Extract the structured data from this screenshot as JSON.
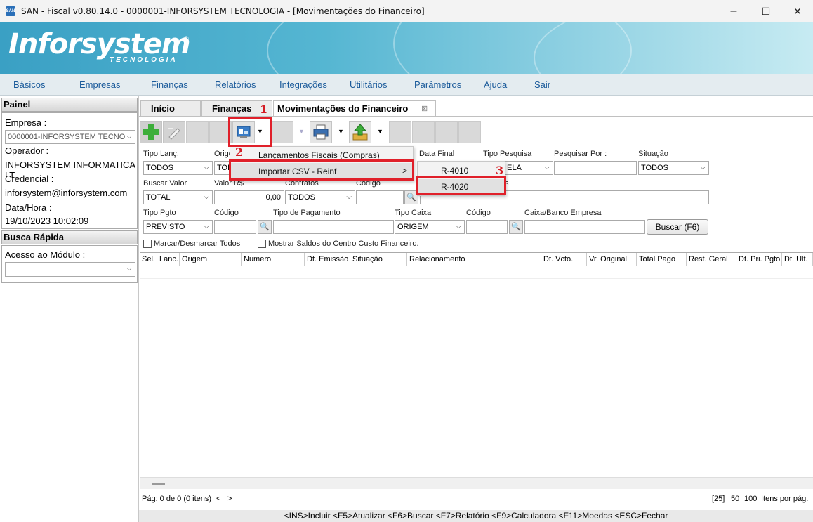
{
  "window": {
    "app_icon_text": "SAN",
    "title": "SAN - Fiscal v0.80.14.0 - 0000001-INFORSYSTEM TECNOLOGIA - [Movimentações do Financeiro]",
    "minimize": "–",
    "maximize": "☐",
    "close": "✕"
  },
  "banner": {
    "logo": "Inforsystem",
    "logo_sub": "TECNOLOGIA",
    "logo_reg": "®"
  },
  "menu": [
    "Básicos",
    "Empresas",
    "Finanças",
    "Relatórios",
    "Integrações",
    "Utilitários",
    "Parâmetros",
    "Ajuda",
    "Sair"
  ],
  "sidebar": {
    "painel": "Painel",
    "empresa_label": "Empresa :",
    "empresa_value": "0000001-INFORSYSTEM TECNO",
    "operador_label": "Operador :",
    "operador_value": "INFORSYSTEM INFORMATICA LT",
    "credencial_label": "Credencial :",
    "credencial_value": "inforsystem@inforsystem.com",
    "datahora_label": "Data/Hora :",
    "datahora_value": "19/10/2023 10:02:09",
    "busca_rapida": "Busca Rápida",
    "acesso_label": "Acesso ao Módulo :",
    "acesso_value": ""
  },
  "tabs": {
    "inicio": "Início",
    "financas": "Finanças",
    "movimentacoes": "Movimentações do Financeiro",
    "close": "⊠"
  },
  "form": {
    "tipo_lanc_label": "Tipo Lanç.",
    "tipo_lanc_value": "TODOS",
    "origem_label": "Orige",
    "origem_value": "TOD",
    "data_final_label": "Data Final",
    "tipo_pesquisa_label": "Tipo Pesquisa",
    "tipo_pesquisa_value": "ELA",
    "pesquisar_por_label": "Pesquisar Por :",
    "situacao_label": "Situação",
    "situacao_value": "TODOS",
    "buscar_valor_label": "Buscar Valor",
    "buscar_valor_value": "TOTAL",
    "valor_label": "Valor R$",
    "valor_value": "0,00",
    "contratos_label": "Contratos",
    "contratos_value": "TODOS",
    "codigo1_label": "Codigo",
    "hidden_label": "s",
    "tipo_pgto_label": "Tipo Pgto",
    "tipo_pgto_value": "PREVISTO",
    "codigo2_label": "Código",
    "tipo_pagamento_label": "Tipo de Pagamento",
    "tipo_caixa_label": "Tipo Caixa",
    "tipo_caixa_value": "ORIGEM",
    "codigo3_label": "Código",
    "caixa_banco_label": "Caixa/Banco Empresa",
    "buscar_button": "Buscar (F6)",
    "marcar_label": "Marcar/Desmarcar Todos",
    "mostrar_label": "Mostrar Saldos do Centro Custo Financeiro."
  },
  "grid": {
    "columns": [
      "Sel.",
      "Lanc.",
      "Origem",
      "Numero",
      "Dt. Emissão",
      "Situação",
      "Relacionamento",
      "Dt. Vcto.",
      "Vr. Original",
      "Total Pago",
      "Rest. Geral",
      "Dt. Pri. Pgto",
      "Dt. Ult."
    ]
  },
  "dropdown": {
    "item1": "Lançamentos Fiscais (Compras)",
    "item2": "Importar CSV - Reinf",
    "submenu_arrow": ">",
    "sub1": "R-4010",
    "sub2": "R-4020"
  },
  "annotations": {
    "one": "1",
    "two": "2",
    "three": "3"
  },
  "pager": {
    "text": "Pág: 0 de 0 (0 itens)",
    "prev": "<",
    "next": ">",
    "page_size_current": "[25]",
    "opt50": "50",
    "opt100": "100",
    "per_page": "Itens por pág."
  },
  "shortcuts": "<INS>Incluir <F5>Atualizar <F6>Buscar <F7>Relatório <F9>Calculadora <F11>Moedas <ESC>Fechar",
  "colors": {
    "accent": "#1a5a9a",
    "annotation": "#e0202a",
    "banner": "#3aa0c4",
    "add_green": "#3cae3a"
  }
}
